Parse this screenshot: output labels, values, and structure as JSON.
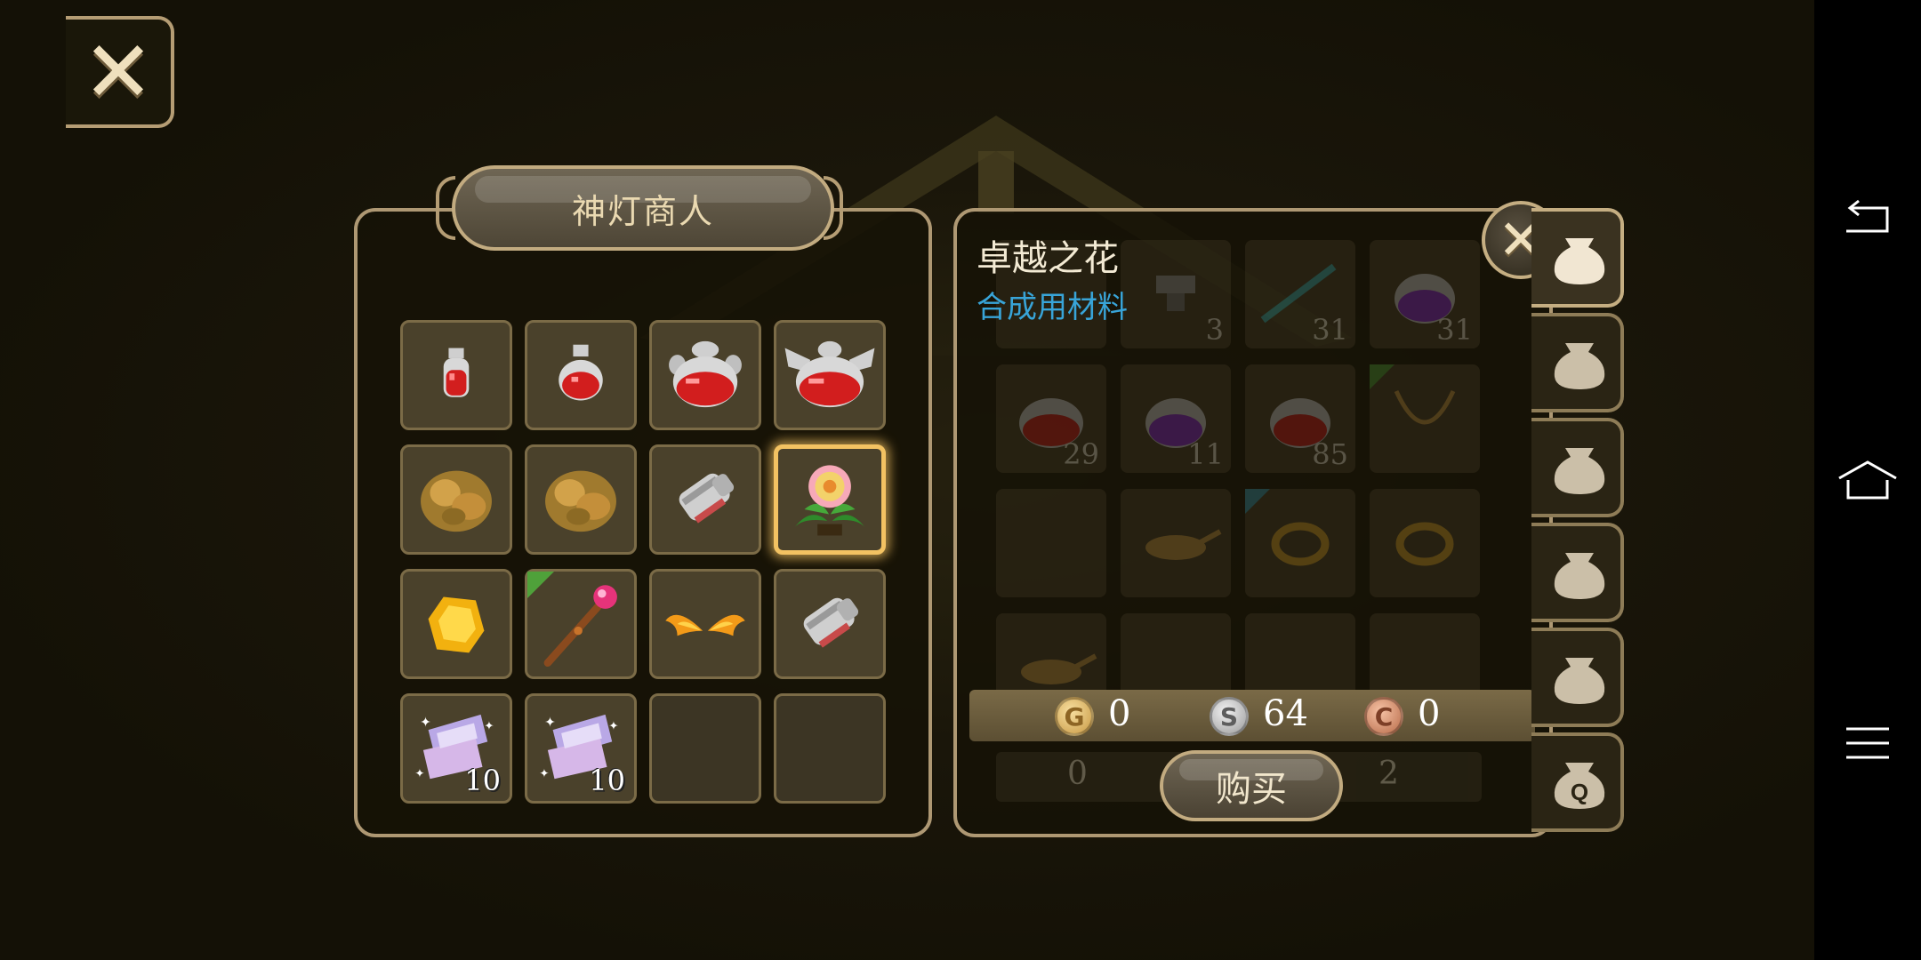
{
  "top_close": {
    "icon": "close-icon"
  },
  "shop": {
    "title": "神灯商人",
    "items": [
      {
        "icon": "small-red-potion-icon"
      },
      {
        "icon": "medium-red-potion-icon"
      },
      {
        "icon": "large-red-potion-icon"
      },
      {
        "icon": "winged-red-potion-icon"
      },
      {
        "icon": "gold-ore-icon"
      },
      {
        "icon": "gold-ore-icon"
      },
      {
        "icon": "silver-gauntlet-icon"
      },
      {
        "icon": "flower-icon",
        "selected": true
      },
      {
        "icon": "yellow-gem-icon"
      },
      {
        "icon": "ruby-staff-icon",
        "badge": "green"
      },
      {
        "icon": "fire-wings-icon"
      },
      {
        "icon": "silver-gauntlet-icon"
      },
      {
        "icon": "sparkle-scroll-icon",
        "quantity": "10"
      },
      {
        "icon": "sparkle-scroll-icon",
        "quantity": "10"
      },
      {
        "icon": ""
      },
      {
        "icon": ""
      }
    ]
  },
  "info": {
    "item_name": "卓越之花",
    "item_type": "合成用材料",
    "price": {
      "gold": "0",
      "silver": "64",
      "copper": "0"
    },
    "coin_labels": {
      "gold": "G",
      "silver": "S",
      "copper": "C"
    },
    "buy_label": "购买",
    "close_icon": "close-icon"
  },
  "inventory_background": {
    "slots": [
      {
        "icon": "",
        "qty": ""
      },
      {
        "icon": "anvil-icon",
        "qty": "3"
      },
      {
        "icon": "teal-dagger-icon",
        "qty": "31"
      },
      {
        "icon": "purple-potion-icon",
        "qty": "31"
      },
      {
        "icon": "winged-red-potion-icon",
        "qty": "29"
      },
      {
        "icon": "purple-potion-icon",
        "qty": "11"
      },
      {
        "icon": "large-red-potion-icon",
        "qty": "85"
      },
      {
        "icon": "gold-necklace-icon",
        "qty": "",
        "badge": "green"
      },
      {
        "icon": "",
        "qty": ""
      },
      {
        "icon": "magic-lamp-icon",
        "qty": ""
      },
      {
        "icon": "gold-ring-icon",
        "qty": "",
        "badge": "cyan"
      },
      {
        "icon": "gold-ring-icon",
        "qty": ""
      },
      {
        "icon": "magic-lamp-icon",
        "qty": ""
      },
      {
        "icon": "",
        "qty": ""
      },
      {
        "icon": "",
        "qty": ""
      },
      {
        "icon": "",
        "qty": ""
      }
    ],
    "money_gold": "0",
    "money_copper": "2"
  },
  "bag_tabs": [
    {
      "icon": "bag-icon",
      "active": true
    },
    {
      "icon": "bag-icon"
    },
    {
      "icon": "bag-icon"
    },
    {
      "icon": "bag-icon"
    },
    {
      "icon": "bag-icon"
    },
    {
      "icon": "quest-bag-icon",
      "label": "Q"
    }
  ],
  "nav": {
    "back": "back-icon",
    "home": "home-icon",
    "menu": "menu-icon"
  }
}
